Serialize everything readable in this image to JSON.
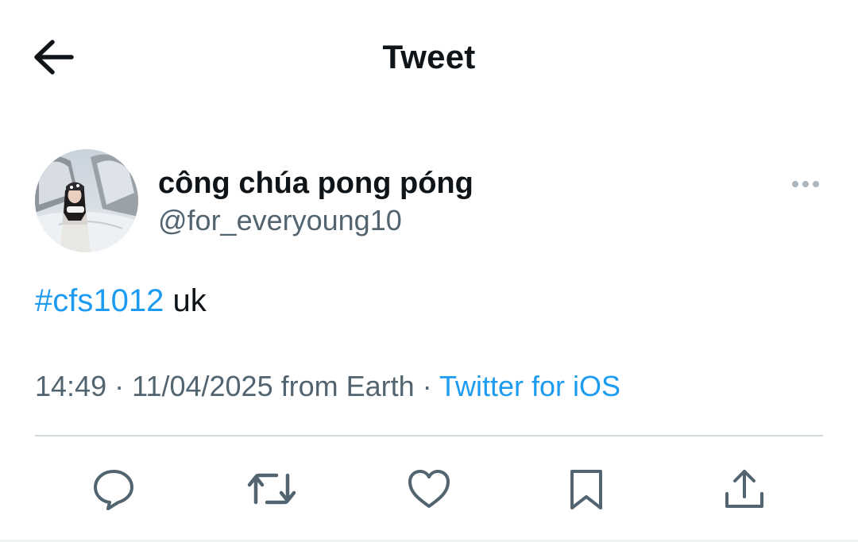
{
  "header": {
    "title": "Tweet",
    "back_icon": "arrow-left-icon"
  },
  "author": {
    "display_name": "công chúa pong póng",
    "handle": "@for_everyoung10",
    "avatar_icon": "avatar-photo",
    "more_icon": "more-horizontal-icon"
  },
  "tweet": {
    "hashtag": "#cfs1012",
    "text": " uk"
  },
  "meta": {
    "time": "14:49",
    "separator1": " · ",
    "date": "11/04/2025",
    "location": " from Earth",
    "separator2": " · ",
    "source": "Twitter for iOS"
  },
  "actions": [
    {
      "name": "reply",
      "icon": "reply-bubble-icon"
    },
    {
      "name": "retweet",
      "icon": "retweet-icon"
    },
    {
      "name": "like",
      "icon": "heart-icon"
    },
    {
      "name": "bookmark",
      "icon": "bookmark-icon"
    },
    {
      "name": "share",
      "icon": "share-icon"
    }
  ],
  "colors": {
    "accent": "#1d9bf0",
    "text": "#0f1419",
    "secondary": "#536471",
    "divider": "#cfd9de"
  }
}
